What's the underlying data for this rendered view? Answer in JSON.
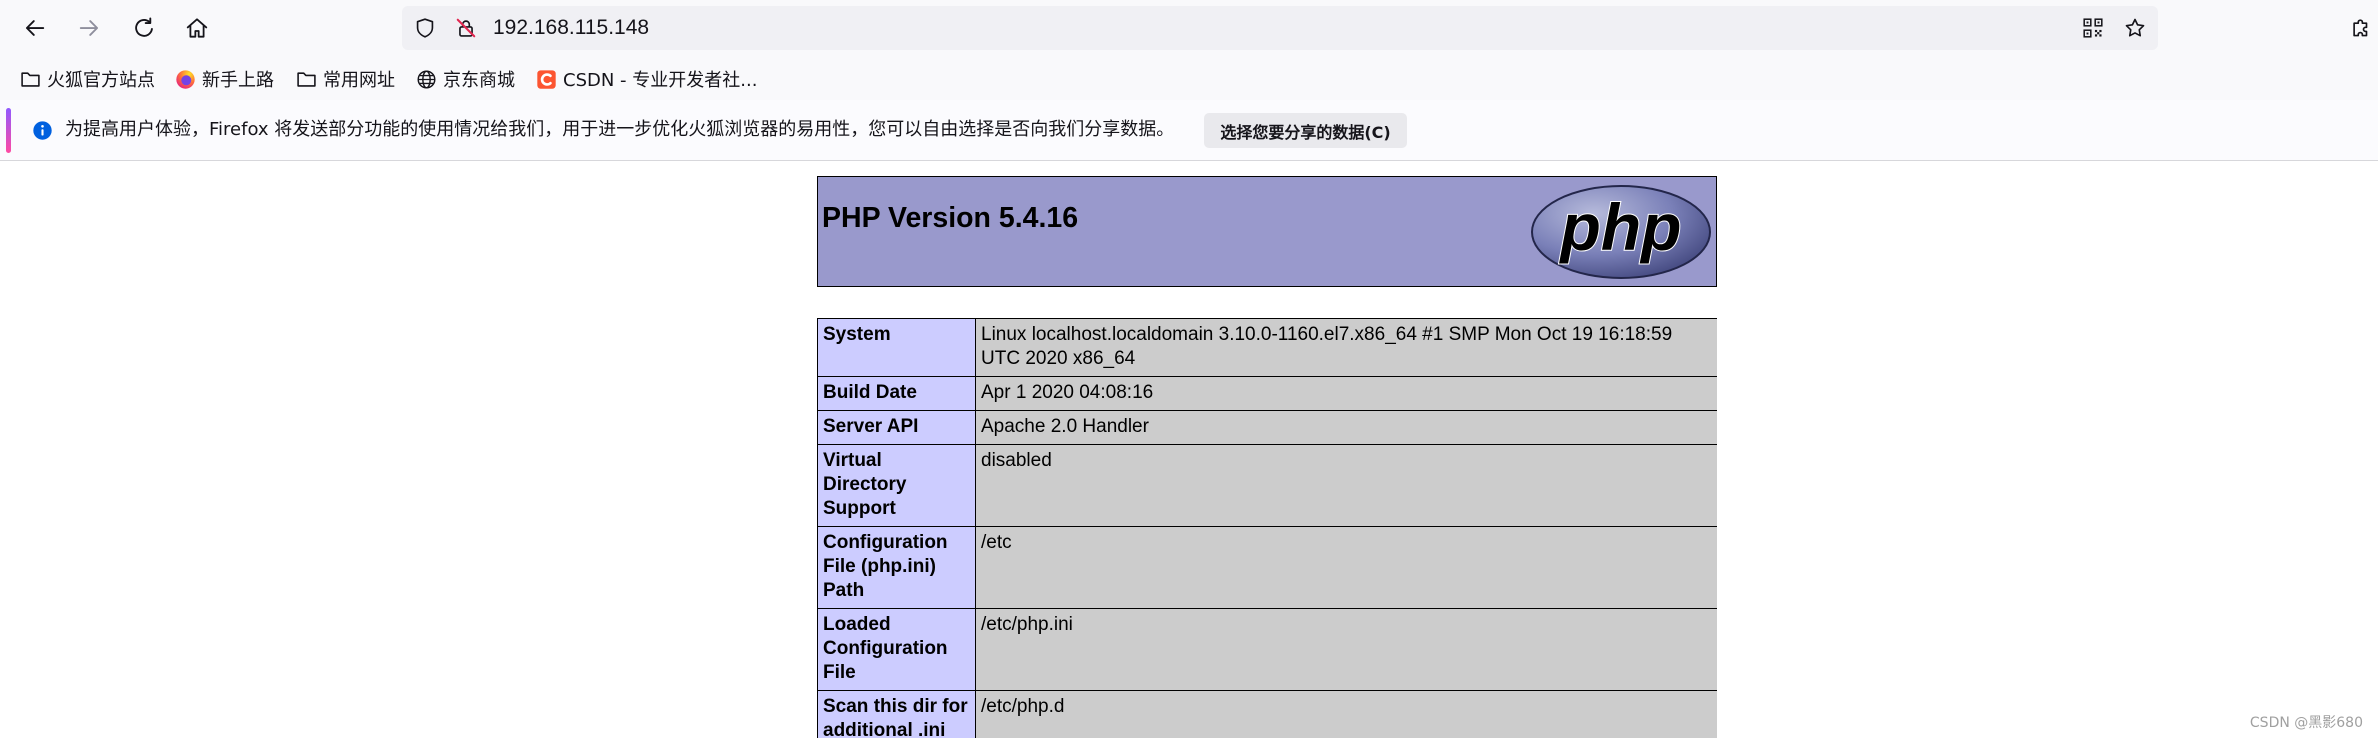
{
  "window": {
    "url": "192.168.115.148"
  },
  "icons": {
    "navigation": [
      "back-icon",
      "forward-icon",
      "reload-icon",
      "home-icon"
    ],
    "urlbar": [
      "tracking-protection-shield-icon",
      "insecure-lock-icon",
      "qr-code-icon",
      "bookmark-star-icon"
    ],
    "toolbar_right": [
      "extensions-icon"
    ],
    "notification": "info-icon"
  },
  "bookmarks": [
    {
      "label": "火狐官方站点",
      "icon": "folder-icon"
    },
    {
      "label": "新手上路",
      "icon": "firefox-icon"
    },
    {
      "label": "常用网址",
      "icon": "folder-icon"
    },
    {
      "label": "京东商城",
      "icon": "globe-icon"
    },
    {
      "label": "CSDN - 专业开发者社...",
      "icon": "csdn-icon"
    }
  ],
  "notification": {
    "message": "为提高用户体验，Firefox 将发送部分功能的使用情况给我们，用于进一步优化火狐浏览器的易用性，您可以自由选择是否向我们分享数据。",
    "button_label": "选择您要分享的数据(C)"
  },
  "phpinfo": {
    "title": "PHP Version 5.4.16",
    "logo_text": "php",
    "rows": [
      {
        "label": "System",
        "value": "Linux localhost.localdomain 3.10.0-1160.el7.x86_64 #1 SMP Mon Oct 19 16:18:59 UTC 2020 x86_64"
      },
      {
        "label": "Build Date",
        "value": "Apr 1 2020 04:08:16"
      },
      {
        "label": "Server API",
        "value": "Apache 2.0 Handler"
      },
      {
        "label": "Virtual\nDirectory\nSupport",
        "value": "disabled"
      },
      {
        "label": "Configuration\nFile (php.ini)\nPath",
        "value": "/etc"
      },
      {
        "label": "Loaded\nConfiguration\nFile",
        "value": "/etc/php.ini"
      },
      {
        "label": "Scan this dir for\nadditional .ini",
        "value": "/etc/php.d"
      }
    ]
  },
  "watermark": "CSDN @黑影680",
  "colors": {
    "header_bg": "#9999cc",
    "label_cell_bg": "#ccccff",
    "value_cell_bg": "#cccccc",
    "urlbar_bg": "#f0f0f4",
    "info_blue": "#0060df",
    "insecure_red": "#e22850",
    "csdn_red": "#fc5531",
    "notification_accent": [
      "#9059ff",
      "#ff4aa2"
    ]
  }
}
